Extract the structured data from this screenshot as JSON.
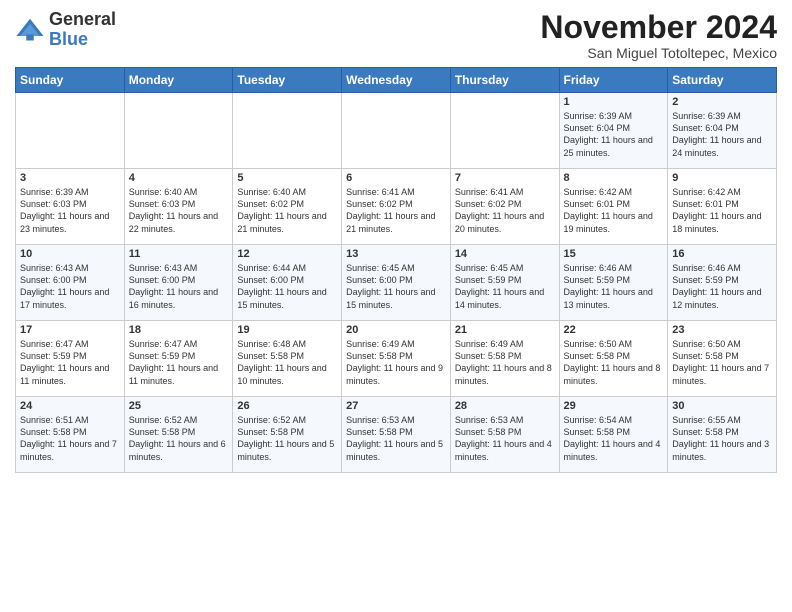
{
  "header": {
    "logo_general": "General",
    "logo_blue": "Blue",
    "month_title": "November 2024",
    "location": "San Miguel Totoltepec, Mexico"
  },
  "columns": [
    "Sunday",
    "Monday",
    "Tuesday",
    "Wednesday",
    "Thursday",
    "Friday",
    "Saturday"
  ],
  "weeks": [
    [
      {
        "day": "",
        "info": ""
      },
      {
        "day": "",
        "info": ""
      },
      {
        "day": "",
        "info": ""
      },
      {
        "day": "",
        "info": ""
      },
      {
        "day": "",
        "info": ""
      },
      {
        "day": "1",
        "info": "Sunrise: 6:39 AM\nSunset: 6:04 PM\nDaylight: 11 hours and 25 minutes."
      },
      {
        "day": "2",
        "info": "Sunrise: 6:39 AM\nSunset: 6:04 PM\nDaylight: 11 hours and 24 minutes."
      }
    ],
    [
      {
        "day": "3",
        "info": "Sunrise: 6:39 AM\nSunset: 6:03 PM\nDaylight: 11 hours and 23 minutes."
      },
      {
        "day": "4",
        "info": "Sunrise: 6:40 AM\nSunset: 6:03 PM\nDaylight: 11 hours and 22 minutes."
      },
      {
        "day": "5",
        "info": "Sunrise: 6:40 AM\nSunset: 6:02 PM\nDaylight: 11 hours and 21 minutes."
      },
      {
        "day": "6",
        "info": "Sunrise: 6:41 AM\nSunset: 6:02 PM\nDaylight: 11 hours and 21 minutes."
      },
      {
        "day": "7",
        "info": "Sunrise: 6:41 AM\nSunset: 6:02 PM\nDaylight: 11 hours and 20 minutes."
      },
      {
        "day": "8",
        "info": "Sunrise: 6:42 AM\nSunset: 6:01 PM\nDaylight: 11 hours and 19 minutes."
      },
      {
        "day": "9",
        "info": "Sunrise: 6:42 AM\nSunset: 6:01 PM\nDaylight: 11 hours and 18 minutes."
      }
    ],
    [
      {
        "day": "10",
        "info": "Sunrise: 6:43 AM\nSunset: 6:00 PM\nDaylight: 11 hours and 17 minutes."
      },
      {
        "day": "11",
        "info": "Sunrise: 6:43 AM\nSunset: 6:00 PM\nDaylight: 11 hours and 16 minutes."
      },
      {
        "day": "12",
        "info": "Sunrise: 6:44 AM\nSunset: 6:00 PM\nDaylight: 11 hours and 15 minutes."
      },
      {
        "day": "13",
        "info": "Sunrise: 6:45 AM\nSunset: 6:00 PM\nDaylight: 11 hours and 15 minutes."
      },
      {
        "day": "14",
        "info": "Sunrise: 6:45 AM\nSunset: 5:59 PM\nDaylight: 11 hours and 14 minutes."
      },
      {
        "day": "15",
        "info": "Sunrise: 6:46 AM\nSunset: 5:59 PM\nDaylight: 11 hours and 13 minutes."
      },
      {
        "day": "16",
        "info": "Sunrise: 6:46 AM\nSunset: 5:59 PM\nDaylight: 11 hours and 12 minutes."
      }
    ],
    [
      {
        "day": "17",
        "info": "Sunrise: 6:47 AM\nSunset: 5:59 PM\nDaylight: 11 hours and 11 minutes."
      },
      {
        "day": "18",
        "info": "Sunrise: 6:47 AM\nSunset: 5:59 PM\nDaylight: 11 hours and 11 minutes."
      },
      {
        "day": "19",
        "info": "Sunrise: 6:48 AM\nSunset: 5:58 PM\nDaylight: 11 hours and 10 minutes."
      },
      {
        "day": "20",
        "info": "Sunrise: 6:49 AM\nSunset: 5:58 PM\nDaylight: 11 hours and 9 minutes."
      },
      {
        "day": "21",
        "info": "Sunrise: 6:49 AM\nSunset: 5:58 PM\nDaylight: 11 hours and 8 minutes."
      },
      {
        "day": "22",
        "info": "Sunrise: 6:50 AM\nSunset: 5:58 PM\nDaylight: 11 hours and 8 minutes."
      },
      {
        "day": "23",
        "info": "Sunrise: 6:50 AM\nSunset: 5:58 PM\nDaylight: 11 hours and 7 minutes."
      }
    ],
    [
      {
        "day": "24",
        "info": "Sunrise: 6:51 AM\nSunset: 5:58 PM\nDaylight: 11 hours and 7 minutes."
      },
      {
        "day": "25",
        "info": "Sunrise: 6:52 AM\nSunset: 5:58 PM\nDaylight: 11 hours and 6 minutes."
      },
      {
        "day": "26",
        "info": "Sunrise: 6:52 AM\nSunset: 5:58 PM\nDaylight: 11 hours and 5 minutes."
      },
      {
        "day": "27",
        "info": "Sunrise: 6:53 AM\nSunset: 5:58 PM\nDaylight: 11 hours and 5 minutes."
      },
      {
        "day": "28",
        "info": "Sunrise: 6:53 AM\nSunset: 5:58 PM\nDaylight: 11 hours and 4 minutes."
      },
      {
        "day": "29",
        "info": "Sunrise: 6:54 AM\nSunset: 5:58 PM\nDaylight: 11 hours and 4 minutes."
      },
      {
        "day": "30",
        "info": "Sunrise: 6:55 AM\nSunset: 5:58 PM\nDaylight: 11 hours and 3 minutes."
      }
    ]
  ]
}
